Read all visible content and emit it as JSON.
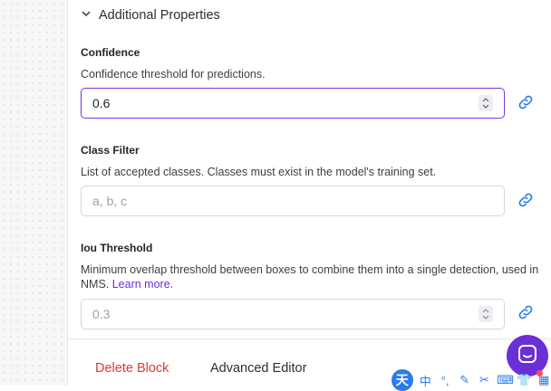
{
  "section": {
    "title": "Additional Properties",
    "expanded": true
  },
  "fields": [
    {
      "label": "Confidence",
      "description": "Confidence threshold for predictions.",
      "value": "0.6",
      "placeholder": "",
      "type": "number"
    },
    {
      "label": "Class Filter",
      "description": "List of accepted classes. Classes must exist in the model's training set.",
      "value": "",
      "placeholder": "a, b, c",
      "type": "text"
    },
    {
      "label": "Iou Threshold",
      "description": "Minimum overlap threshold between boxes to combine them into a single detection, used in NMS.",
      "learn_more": "Learn more.",
      "value": "",
      "placeholder": "0.3",
      "type": "number"
    }
  ],
  "footer": {
    "delete_label": "Delete Block",
    "advanced_label": "Advanced Editor"
  },
  "ime": {
    "logo": "天",
    "items": [
      "中",
      "°,",
      "✎",
      "✂",
      "⌨",
      "👕",
      "▦"
    ]
  },
  "colors": {
    "accent": "#6b2fd8",
    "focus_border": "#7b3fe4",
    "danger": "#d93a3a",
    "link_icon": "#2b7bf0"
  },
  "icons": {
    "section_toggle": "chevron-down-icon",
    "variable_link": "link-icon",
    "chat": "chat-bubble-icon"
  }
}
